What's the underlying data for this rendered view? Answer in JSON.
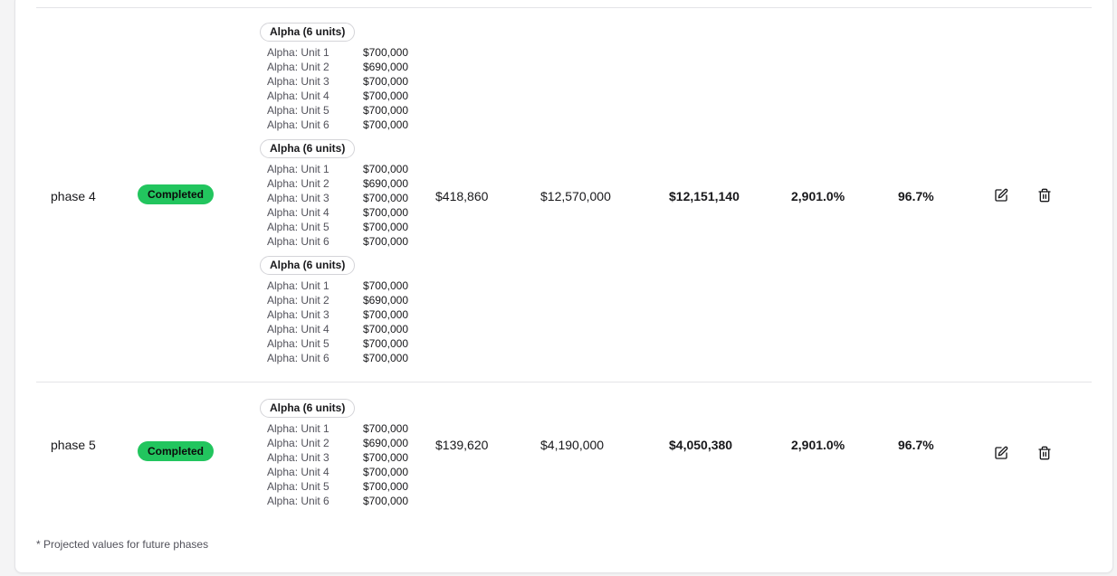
{
  "table": {
    "rows": [
      {
        "phase": "phase 4",
        "status": "Completed",
        "groups": [
          {
            "label": "Alpha (6 units)",
            "units": [
              {
                "name": "Alpha: Unit 1",
                "price": "$700,000"
              },
              {
                "name": "Alpha: Unit 2",
                "price": "$690,000"
              },
              {
                "name": "Alpha: Unit 3",
                "price": "$700,000"
              },
              {
                "name": "Alpha: Unit 4",
                "price": "$700,000"
              },
              {
                "name": "Alpha: Unit 5",
                "price": "$700,000"
              },
              {
                "name": "Alpha: Unit 6",
                "price": "$700,000"
              }
            ]
          },
          {
            "label": "Alpha (6 units)",
            "units": [
              {
                "name": "Alpha: Unit 1",
                "price": "$700,000"
              },
              {
                "name": "Alpha: Unit 2",
                "price": "$690,000"
              },
              {
                "name": "Alpha: Unit 3",
                "price": "$700,000"
              },
              {
                "name": "Alpha: Unit 4",
                "price": "$700,000"
              },
              {
                "name": "Alpha: Unit 5",
                "price": "$700,000"
              },
              {
                "name": "Alpha: Unit 6",
                "price": "$700,000"
              }
            ]
          },
          {
            "label": "Alpha (6 units)",
            "units": [
              {
                "name": "Alpha: Unit 1",
                "price": "$700,000"
              },
              {
                "name": "Alpha: Unit 2",
                "price": "$690,000"
              },
              {
                "name": "Alpha: Unit 3",
                "price": "$700,000"
              },
              {
                "name": "Alpha: Unit 4",
                "price": "$700,000"
              },
              {
                "name": "Alpha: Unit 5",
                "price": "$700,000"
              },
              {
                "name": "Alpha: Unit 6",
                "price": "$700,000"
              }
            ]
          }
        ],
        "cost": "$418,860",
        "revenue": "$12,570,000",
        "profit": "$12,151,140",
        "roi": "2,901.0%",
        "margin": "96.7%"
      },
      {
        "phase": "phase 5",
        "status": "Completed",
        "groups": [
          {
            "label": "Alpha (6 units)",
            "units": [
              {
                "name": "Alpha: Unit 1",
                "price": "$700,000"
              },
              {
                "name": "Alpha: Unit 2",
                "price": "$690,000"
              },
              {
                "name": "Alpha: Unit 3",
                "price": "$700,000"
              },
              {
                "name": "Alpha: Unit 4",
                "price": "$700,000"
              },
              {
                "name": "Alpha: Unit 5",
                "price": "$700,000"
              },
              {
                "name": "Alpha: Unit 6",
                "price": "$700,000"
              }
            ]
          }
        ],
        "cost": "$139,620",
        "revenue": "$4,190,000",
        "profit": "$4,050,380",
        "roi": "2,901.0%",
        "margin": "96.7%"
      }
    ],
    "actions": {
      "edit_icon": "edit-icon",
      "delete_icon": "trash-icon"
    }
  },
  "footnote": "* Projected values for future phases",
  "colors": {
    "status_completed": "#22c55e",
    "border": "#e4e4e7",
    "muted_text": "#52525b"
  }
}
